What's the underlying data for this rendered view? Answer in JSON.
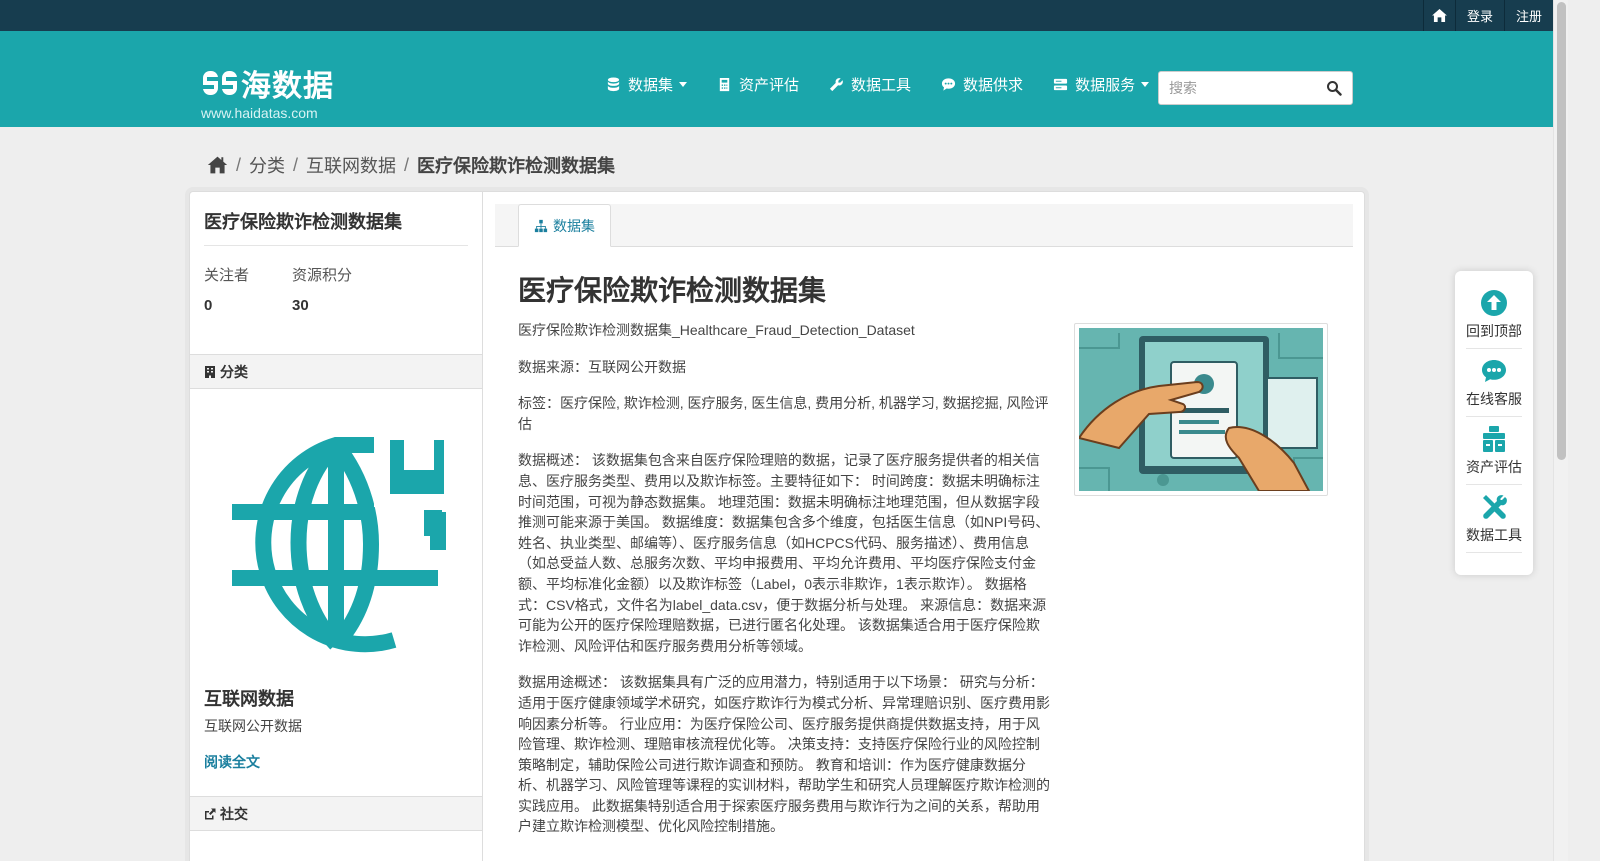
{
  "topbar": {
    "login": "登录",
    "register": "注册"
  },
  "site": {
    "name": "海数据",
    "url": "www.haidatas.com"
  },
  "nav": [
    {
      "label": "数据集",
      "icon": "database-icon",
      "dropdown": true
    },
    {
      "label": "资产评估",
      "icon": "calculator-icon",
      "dropdown": false
    },
    {
      "label": "数据工具",
      "icon": "wrench-icon",
      "dropdown": false
    },
    {
      "label": "数据供求",
      "icon": "comment-icon",
      "dropdown": false
    },
    {
      "label": "数据服务",
      "icon": "server-icon",
      "dropdown": true
    }
  ],
  "search": {
    "placeholder": "搜索"
  },
  "breadcrumb": {
    "category": "分类",
    "group": "互联网数据",
    "current": "医疗保险欺诈检测数据集"
  },
  "sidebar": {
    "title": "医疗保险欺诈检测数据集",
    "followers_label": "关注者",
    "followers_value": "0",
    "points_label": "资源积分",
    "points_value": "30",
    "category_heading": "分类",
    "org_title": "互联网数据",
    "org_desc": "互联网公开数据",
    "read_more": "阅读全文",
    "social_heading": "社交"
  },
  "tab": {
    "label": "数据集"
  },
  "dataset": {
    "title": "医疗保险欺诈检测数据集",
    "paragraphs": [
      "医疗保险欺诈检测数据集_Healthcare_Fraud_Detection_Dataset",
      "数据来源：互联网公开数据",
      "标签：医疗保险, 欺诈检测, 医疗服务, 医生信息, 费用分析, 机器学习, 数据挖掘, 风险评估",
      "数据概述： 该数据集包含来自医疗保险理赔的数据，记录了医疗服务提供者的相关信息、医疗服务类型、费用以及欺诈标签。主要特征如下： 时间跨度：数据未明确标注时间范围，可视为静态数据集。 地理范围：数据未明确标注地理范围，但从数据字段推测可能来源于美国。 数据维度：数据集包含多个维度，包括医生信息（如NPI号码、姓名、执业类型、邮编等）、医疗服务信息（如HCPCS代码、服务描述）、费用信息（如总受益人数、总服务次数、平均申报费用、平均允许费用、平均医疗保险支付金额、平均标准化金额）以及欺诈标签（Label，0表示非欺诈，1表示欺诈）。 数据格式：CSV格式，文件名为label_data.csv，便于数据分析与处理。 来源信息：数据来源可能为公开的医疗保险理赔数据，已进行匿名化处理。 该数据集适合用于医疗保险欺诈检测、风险评估和医疗服务费用分析等领域。",
      "数据用途概述： 该数据集具有广泛的应用潜力，特别适用于以下场景： 研究与分析：适用于医疗健康领域学术研究，如医疗欺诈行为模式分析、异常理赔识别、医疗费用影响因素分析等。 行业应用：为医疗保险公司、医疗服务提供商提供数据支持，用于风险管理、欺诈检测、理赔审核流程优化等。 决策支持：支持医疗保险行业的风险控制策略制定，辅助保险公司进行欺诈调查和预防。 教育和培训：作为医疗健康数据分析、机器学习、风险管理等课程的实训材料，帮助学生和研究人员理解医疗欺诈检测的实践应用。 此数据集特别适合用于探索医疗服务费用与欺诈行为之间的关系，帮助用户建立欺诈检测模型、优化风险控制措施。"
    ]
  },
  "toolbox": [
    {
      "label": "回到顶部",
      "icon": "arrow-up-circle-icon"
    },
    {
      "label": "在线客服",
      "icon": "chat-bubble-icon"
    },
    {
      "label": "资产评估",
      "icon": "assessment-icon"
    },
    {
      "label": "数据工具",
      "icon": "tools-icon"
    }
  ],
  "colors": {
    "brand": "#1ba6ab",
    "topbar": "#173d4f",
    "link": "#1a7f9e"
  }
}
